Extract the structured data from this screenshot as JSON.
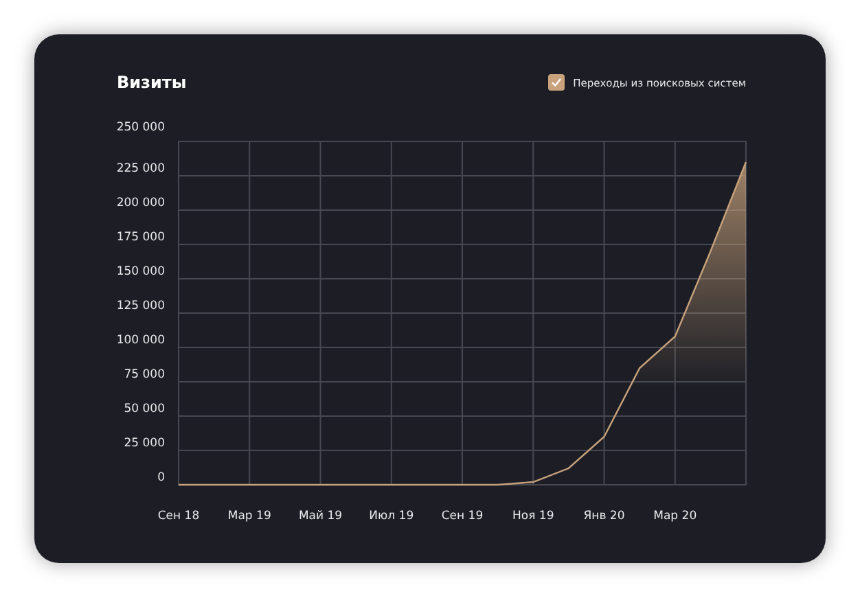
{
  "title": "Визиты",
  "legend": {
    "checked": true
  },
  "chart_data": {
    "type": "area",
    "categories": [
      "Сен 18",
      null,
      "Мар 19",
      null,
      "Май 19",
      null,
      "Июл 19",
      null,
      "Сен 19",
      null,
      "Ноя 19",
      null,
      "Янв 20",
      null,
      "Мар 20",
      null,
      null
    ],
    "series": [
      {
        "name": "Переходы из поисковых систем",
        "color": "#c8a27c",
        "values": [
          0,
          0,
          0,
          0,
          0,
          0,
          0,
          0,
          0,
          0,
          2000,
          12000,
          35000,
          85000,
          108000,
          170000,
          235000
        ]
      }
    ],
    "ylim": [
      0,
      250000
    ],
    "grid": true,
    "yticks": [
      {
        "value": 0,
        "label": "0"
      },
      {
        "value": 25000,
        "label": "25 000"
      },
      {
        "value": 50000,
        "label": "50 000"
      },
      {
        "value": 75000,
        "label": "75 000"
      },
      {
        "value": 100000,
        "label": "100 000"
      },
      {
        "value": 125000,
        "label": "125 000"
      },
      {
        "value": 150000,
        "label": "150 000"
      },
      {
        "value": 175000,
        "label": "175 000"
      },
      {
        "value": 200000,
        "label": "200 000"
      },
      {
        "value": 225000,
        "label": "225 000"
      },
      {
        "value": 250000,
        "label": "250 000"
      }
    ]
  }
}
